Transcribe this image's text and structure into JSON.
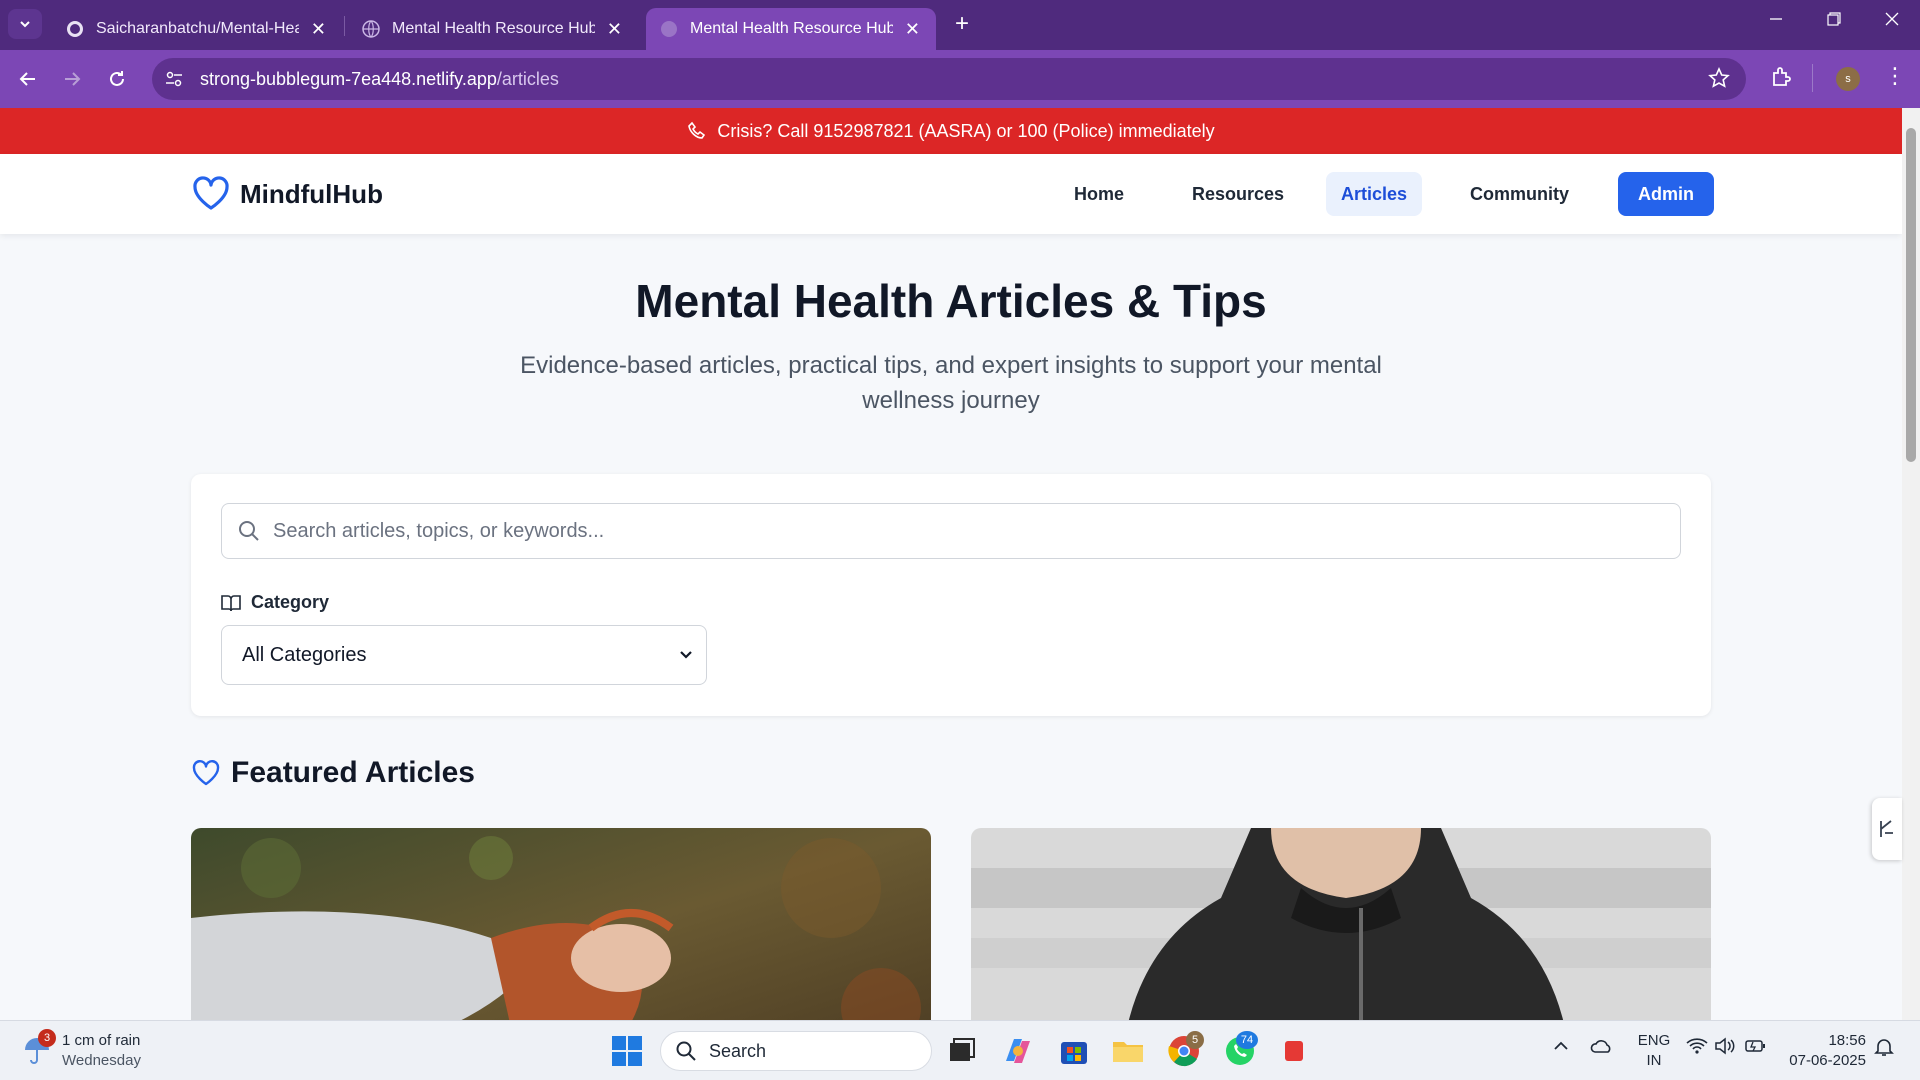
{
  "browser": {
    "tabs": [
      {
        "title": "Saicharanbatchu/Mental-Health-Resource-Hub",
        "active": false
      },
      {
        "title": "Mental Health Resource Hub - Support",
        "active": false
      },
      {
        "title": "Mental Health Resource Hub - Support",
        "active": true
      }
    ],
    "url_host": "strong-bubblegum-7ea448.netlify.app",
    "url_path": "/articles",
    "profile_initial": "s",
    "new_tab": "+",
    "close_glyph": "✕"
  },
  "site": {
    "crisis_banner": "Crisis? Call 9152987821 (AASRA) or 100 (Police) immediately",
    "logo_text": "MindfulHub",
    "nav": {
      "home": "Home",
      "resources": "Resources",
      "articles": "Articles",
      "community": "Community",
      "admin": "Admin"
    },
    "active_nav": "Articles",
    "accent_color": "#2563eb",
    "banner_color": "#dc2626"
  },
  "hero": {
    "title": "Mental Health Articles & Tips",
    "subtitle": "Evidence-based articles, practical tips, and expert insights to support your mental wellness journey"
  },
  "filters": {
    "search_placeholder": "Search articles, topics, or keywords...",
    "category_label": "Category",
    "category_value": "All Categories"
  },
  "featured": {
    "heading": "Featured Articles"
  },
  "taskbar": {
    "weather_main": "1 cm of rain",
    "weather_sub": "Wednesday",
    "weather_badge": "3",
    "search_label": "Search",
    "chrome_badge": "5",
    "whatsapp_badge": "74",
    "lang_top": "ENG",
    "lang_bottom": "IN",
    "time": "18:56",
    "date": "07-06-2025"
  }
}
